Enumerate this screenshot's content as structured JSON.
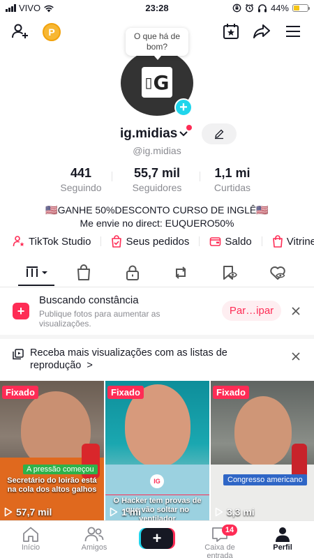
{
  "status": {
    "carrier": "VIVO",
    "time": "23:28",
    "battery": "44%",
    "battery_level": 0.44
  },
  "bubble": {
    "text": "O que há de bom?"
  },
  "avatar": {
    "logo_text": "G"
  },
  "profile": {
    "username": "ig.midias",
    "handle": "@ig.midias"
  },
  "stats": [
    {
      "value": "441",
      "label": "Seguindo"
    },
    {
      "value": "55,7 mil",
      "label": "Seguidores"
    },
    {
      "value": "1,1 mi",
      "label": "Curtidas"
    }
  ],
  "bio": {
    "line1": "🇺🇸GANHE 50%DESCONTO CURSO DE INGLÊ🇺🇸",
    "line2": "Me envie no direct: EUQUERO50%"
  },
  "links": [
    {
      "label": "TikTok Studio",
      "icon": "person-star-icon"
    },
    {
      "label": "Seus pedidos",
      "icon": "orders-icon"
    },
    {
      "label": "Saldo",
      "icon": "wallet-icon"
    },
    {
      "label": "Vitrine",
      "icon": "shopping-bag-icon"
    }
  ],
  "promo": {
    "title": "Buscando constância",
    "desc": "Publique fotos para aumentar as visualizações.",
    "cta": "Par…ipar"
  },
  "playlist": {
    "text": "Receba mais visualizações com as listas de reprodução",
    "chevron": ">"
  },
  "videos": [
    {
      "pinned": "Fixado",
      "tag": "A pressão começou",
      "caption": "Secretário do loirão está na cola dos altos galhos",
      "views": "57,7 mil"
    },
    {
      "pinned": "Fixado",
      "tag": "IG",
      "caption": "O Hacker tem provas de que vão soltar no ventilador",
      "views": "1 mi"
    },
    {
      "pinned": "Fixado",
      "tag": "Congresso americano",
      "caption": "",
      "views": "3,3 mi"
    }
  ],
  "nav": {
    "home": "Início",
    "friends": "Amigos",
    "create": "+",
    "inbox": "Caixa de entrada",
    "inbox_badge": "14",
    "profile": "Perfil"
  },
  "colors": {
    "accent": "#fe2c55",
    "cyan": "#20d5ec",
    "coin": "#f7b733"
  }
}
